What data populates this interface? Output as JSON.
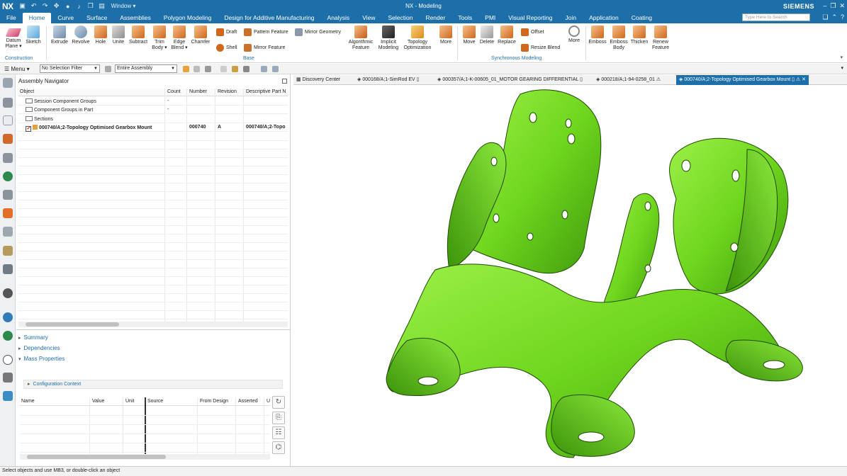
{
  "app": {
    "logo": "NX",
    "title": "NX - Modeling",
    "window_menu": "Window ▾",
    "brand": "SIEMENS",
    "search_placeholder": "Type Here to Search"
  },
  "menu_tabs": [
    "File",
    "Home",
    "Curve",
    "Surface",
    "Assemblies",
    "Polygon Modeling",
    "Design for Additive Manufacturing",
    "Analysis",
    "View",
    "Selection",
    "Render",
    "Tools",
    "PMI",
    "Visual Reporting",
    "Join",
    "Application",
    "Coating"
  ],
  "active_tab": "Home",
  "ribbon": {
    "construction": {
      "datum_plane": "Datum",
      "datum_plane_2": "Plane ▾",
      "sketch": "Sketch",
      "group": "Construction"
    },
    "base": {
      "extrude": "Extrude",
      "revolve": "Revolve",
      "hole": "Hole",
      "unite": "Unite",
      "subtract": "Subtract",
      "trim_body": "Trim",
      "trim_body_2": "Body ▾",
      "edge_blend": "Edge",
      "edge_blend_2": "Blend ▾",
      "chamfer": "Chamfer",
      "draft": "Draft",
      "shell": "Shell",
      "pattern_feature": "Pattern Feature",
      "mirror_feature": "Mirror Feature",
      "mirror_geometry": "Mirror Geometry",
      "algorithmic": "Algorithmic",
      "algorithmic_2": "Feature",
      "implicit": "Implicit",
      "implicit_2": "Modeling",
      "topology": "Topology",
      "topology_2": "Optimization",
      "more": "More",
      "group": "Base"
    },
    "sync": {
      "move": "Move",
      "delete": "Delete",
      "replace": "Replace",
      "offset": "Offset",
      "resize_blend": "Resize Blend",
      "more": "More",
      "group": "Synchronous Modeling"
    },
    "emboss": {
      "emboss": "Emboss",
      "emboss_body": "Emboss",
      "emboss_body_2": "Body",
      "thicken": "Thicken",
      "renew": "Renew",
      "renew_2": "Feature"
    }
  },
  "selection_bar": {
    "menu": "☰ Menu ▾",
    "filter": "No Selection Filter",
    "scope": "Entire Assembly"
  },
  "navigator": {
    "title": "Assembly Navigator",
    "columns": [
      "Object",
      "Count",
      "Number",
      "Revision",
      "Descriptive Part N"
    ],
    "rows": [
      {
        "object": "Session Component Groups",
        "count": "-",
        "number": "",
        "revision": "",
        "desc": ""
      },
      {
        "object": "Component Groups in Part",
        "count": "-",
        "number": "",
        "revision": "",
        "desc": ""
      },
      {
        "object": "Sections",
        "count": "",
        "number": "",
        "revision": "",
        "desc": ""
      },
      {
        "object": "000740/A;2-Topology Optimised Gearbox Mount",
        "count": "",
        "number": "000740",
        "revision": "A",
        "desc": "000740/A;2-Topo"
      }
    ]
  },
  "panels": {
    "summary": "Summary",
    "dependencies": "Dependencies",
    "mass_properties": "Mass Properties",
    "config_context": "Configuration Context",
    "mass_columns": [
      "Name",
      "Value",
      "Unit",
      "Source",
      "From Design",
      "Asserted",
      "U"
    ]
  },
  "graphics_tabs": [
    {
      "label": "Discovery Center"
    },
    {
      "label": "000168/A;1-SimRod EV"
    },
    {
      "label": "000357/A;1-K-00605_01_MOTOR GEARING DIFFERENTIAL"
    },
    {
      "label": "000218/A;1-94-0258_01"
    },
    {
      "label": "000740/A;2-Topology Optimised Gearbox Mount"
    }
  ],
  "model_color": "#6fd61e",
  "status": "Select objects and use MB3, or double-click an object"
}
